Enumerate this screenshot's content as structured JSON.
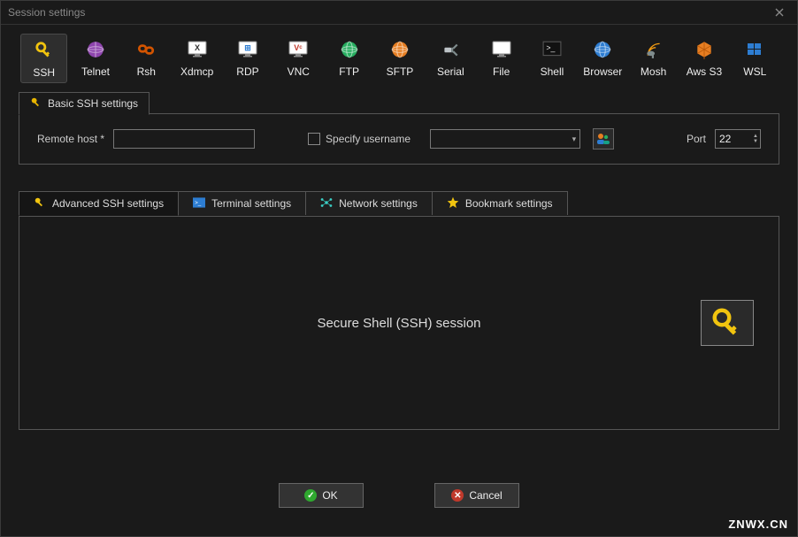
{
  "window": {
    "title": "Session settings"
  },
  "types": [
    {
      "id": "ssh",
      "label": "SSH",
      "icon": "key",
      "selected": true
    },
    {
      "id": "telnet",
      "label": "Telnet",
      "icon": "globe-purple"
    },
    {
      "id": "rsh",
      "label": "Rsh",
      "icon": "chain"
    },
    {
      "id": "xdmcp",
      "label": "Xdmcp",
      "icon": "monitor-x"
    },
    {
      "id": "rdp",
      "label": "RDP",
      "icon": "monitor-win"
    },
    {
      "id": "vnc",
      "label": "VNC",
      "icon": "monitor-vnc"
    },
    {
      "id": "ftp",
      "label": "FTP",
      "icon": "globe-green"
    },
    {
      "id": "sftp",
      "label": "SFTP",
      "icon": "globe-orange"
    },
    {
      "id": "serial",
      "label": "Serial",
      "icon": "plug"
    },
    {
      "id": "file",
      "label": "File",
      "icon": "monitor-file"
    },
    {
      "id": "shell",
      "label": "Shell",
      "icon": "terminal"
    },
    {
      "id": "browser",
      "label": "Browser",
      "icon": "globe-blue"
    },
    {
      "id": "mosh",
      "label": "Mosh",
      "icon": "satellite"
    },
    {
      "id": "aws",
      "label": "Aws S3",
      "icon": "aws"
    },
    {
      "id": "wsl",
      "label": "WSL",
      "icon": "win-logo"
    }
  ],
  "basic": {
    "tab_label": "Basic SSH settings",
    "remote_host_label": "Remote host *",
    "remote_host_value": "",
    "specify_username_label": "Specify username",
    "specify_username_checked": false,
    "username_value": "",
    "port_label": "Port",
    "port_value": "22"
  },
  "secondary_tabs": [
    {
      "id": "adv",
      "label": "Advanced SSH settings",
      "icon": "key-small",
      "active": true
    },
    {
      "id": "term",
      "label": "Terminal settings",
      "icon": "terminal-small"
    },
    {
      "id": "net",
      "label": "Network settings",
      "icon": "network-small"
    },
    {
      "id": "bm",
      "label": "Bookmark settings",
      "icon": "star-small"
    }
  ],
  "content": {
    "description": "Secure Shell (SSH) session"
  },
  "footer": {
    "ok": "OK",
    "cancel": "Cancel"
  },
  "watermark": "ZNWX.CN"
}
